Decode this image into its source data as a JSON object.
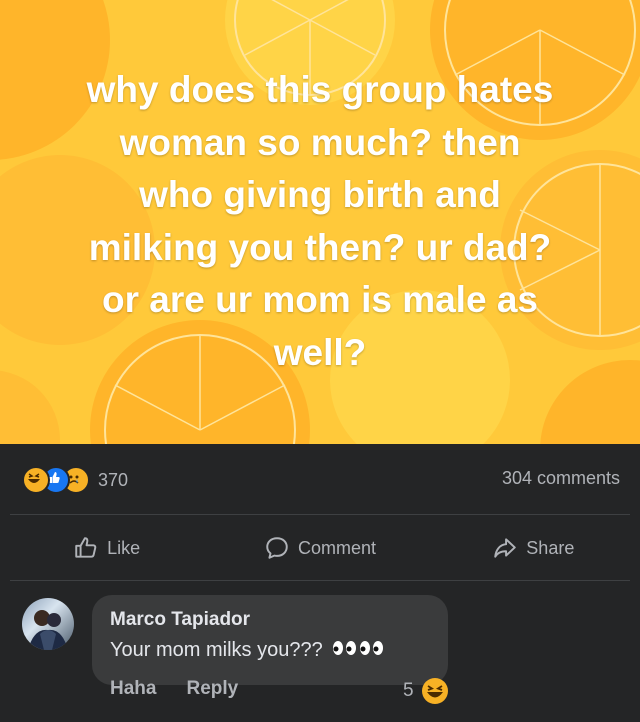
{
  "post": {
    "text_lines": [
      "why does this group hates",
      "woman so much? then",
      "who giving birth and",
      "milking you then? ur dad?",
      "or are ur mom is male as",
      "well?"
    ],
    "background_color": "#ffc93a",
    "text_color": "#ffffff"
  },
  "meta": {
    "reaction_icons": [
      "haha-icon",
      "like-icon",
      "sad-icon"
    ],
    "reaction_count": "370",
    "comments_count": "304 comments"
  },
  "actions": {
    "like": "Like",
    "comment": "Comment",
    "share": "Share"
  },
  "comment": {
    "author": "Marco Tapiador",
    "text": "Your mom milks you???",
    "haha_label": "Haha",
    "reply_label": "Reply",
    "reaction_count": "5"
  },
  "colors": {
    "app_bg": "#242526",
    "bubble_bg": "#3a3b3c",
    "secondary_text": "#b0b3b8",
    "primary_text": "#e4e6eb",
    "like_blue": "#1877f2"
  }
}
